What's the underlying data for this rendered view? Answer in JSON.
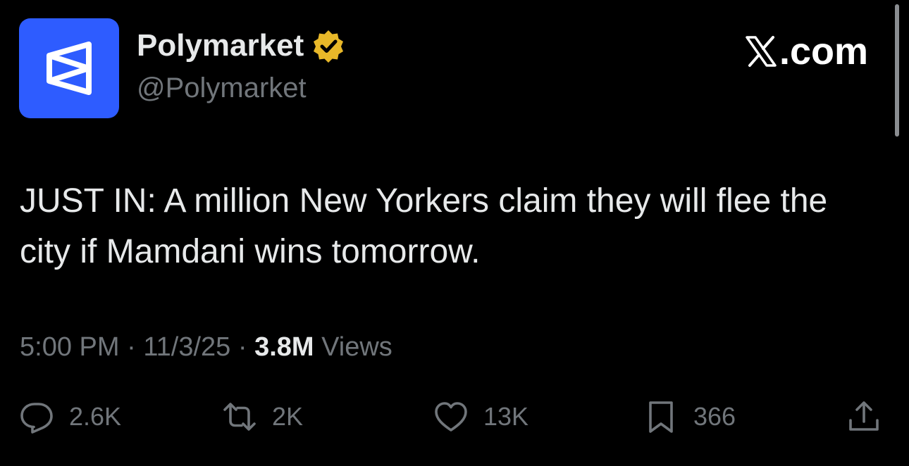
{
  "author": {
    "display_name": "Polymarket",
    "handle": "@Polymarket",
    "avatar_icon": "polymarket-logo",
    "avatar_color": "#2e5cff",
    "verified_badge_color": "#e8b829"
  },
  "watermark": {
    "icon": "x-logo",
    "suffix": ".com"
  },
  "tweet": {
    "text": "JUST IN: A million New Yorkers claim they will flee the city if Mamdani wins tomorrow."
  },
  "meta": {
    "time": "5:00 PM",
    "separator": " · ",
    "date": "11/3/25",
    "views_count": "3.8M",
    "views_label": " Views"
  },
  "actions": {
    "reply": {
      "icon": "reply-icon",
      "count": "2.6K"
    },
    "repost": {
      "icon": "repost-icon",
      "count": "2K"
    },
    "like": {
      "icon": "heart-icon",
      "count": "13K"
    },
    "bookmark": {
      "icon": "bookmark-icon",
      "count": "366"
    },
    "share": {
      "icon": "share-icon"
    }
  },
  "colors": {
    "background": "#000000",
    "primary_text": "#e7e9ea",
    "secondary_text": "#71767b"
  }
}
